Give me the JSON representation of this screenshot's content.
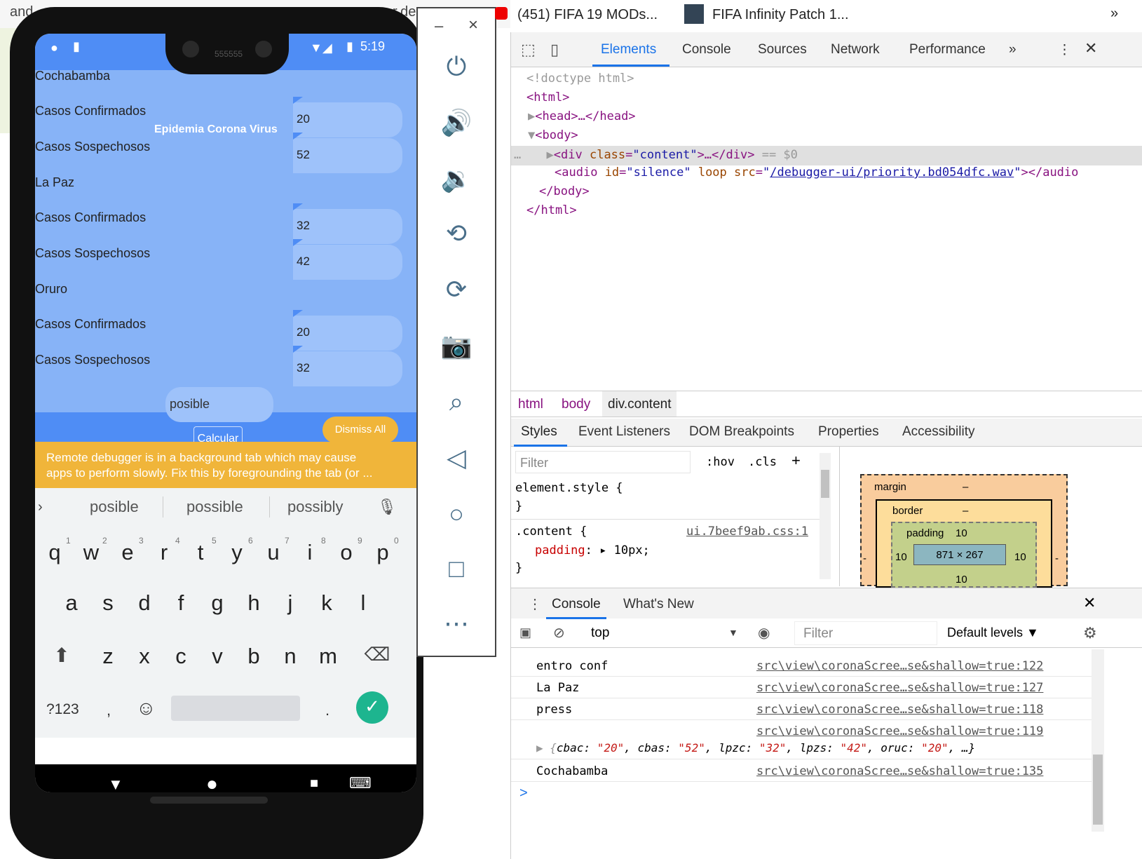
{
  "background": {
    "top_frag_left": "and",
    "top_frag_right": "r.de",
    "frag_1": "n",
    "frag_2": "t"
  },
  "browser_tabs": [
    {
      "label": "(451) FIFA 19 MODs..."
    },
    {
      "label": "FIFA Infinity Patch 1..."
    }
  ],
  "browser_more": "»",
  "phone": {
    "status": {
      "time": "5:19",
      "notch_text": "555555"
    },
    "app": {
      "title": "Epidemia Corona Virus",
      "sections": [
        {
          "name": "Cochabamba",
          "fields": [
            {
              "label": "Casos Confirmados",
              "value": "20"
            },
            {
              "label": "Casos Sospechosos",
              "value": "52"
            }
          ]
        },
        {
          "name": "La Paz",
          "fields": [
            {
              "label": "Casos Confirmados",
              "value": "32"
            },
            {
              "label": "Casos Sospechosos",
              "value": "42"
            }
          ]
        },
        {
          "name": "Oruro",
          "fields": [
            {
              "label": "Casos Confirmados",
              "value": "20"
            },
            {
              "label": "Casos Sospechosos",
              "value": "32"
            }
          ]
        }
      ],
      "input_value": "posible",
      "calc_button": "Calcular",
      "dismiss_button": "Dismiss All",
      "banner_line1": "Remote debugger is in a background tab which may cause",
      "banner_line2": "apps to perform slowly. Fix this by foregrounding the tab (or ..."
    },
    "keyboard": {
      "suggestions": [
        "posible",
        "possible",
        "possibly"
      ],
      "row1": [
        "q",
        "w",
        "e",
        "r",
        "t",
        "y",
        "u",
        "i",
        "o",
        "p"
      ],
      "row1_nums": [
        "1",
        "2",
        "3",
        "4",
        "5",
        "6",
        "7",
        "8",
        "9",
        "0"
      ],
      "row2": [
        "a",
        "s",
        "d",
        "f",
        "g",
        "h",
        "j",
        "k",
        "l"
      ],
      "row3": [
        "z",
        "x",
        "c",
        "v",
        "b",
        "n",
        "m"
      ],
      "symbols_key": "?123",
      "comma": ",",
      "period": "."
    }
  },
  "emulator": {
    "minimize": "–",
    "close": "×",
    "icons": [
      "power-icon",
      "volume-up-icon",
      "volume-down-icon",
      "rotate-left-icon",
      "rotate-right-icon",
      "camera-icon",
      "zoom-icon",
      "back-icon",
      "home-icon",
      "overview-icon",
      "more-icon"
    ]
  },
  "devtools": {
    "tabs": [
      "Elements",
      "Console",
      "Sources",
      "Network",
      "Performance"
    ],
    "more_tabs": "»",
    "dom": {
      "doctype": "<!doctype html>",
      "html_open": "<html>",
      "head": "<head>…</head>",
      "body_open": "<body>",
      "div_tag": "div",
      "div_class_attr": "class",
      "div_class_val": "content",
      "div_suffix": ">…</div>",
      "div_eq": "== $0",
      "audio_tag": "audio",
      "audio_id_attr": "id",
      "audio_id_val": "silence",
      "audio_loop": "loop",
      "audio_src_attr": "src",
      "audio_src_val": "/debugger-ui/priority.bd054dfc.wav",
      "audio_close": "></audio",
      "body_close": "</body>",
      "html_close": "</html>"
    },
    "breadcrumb": [
      "html",
      "body",
      "div.content"
    ],
    "subtabs": [
      "Styles",
      "Event Listeners",
      "DOM Breakpoints",
      "Properties",
      "Accessibility"
    ],
    "styles": {
      "filter_placeholder": "Filter",
      "hov": ":hov",
      "cls": ".cls",
      "add": "+",
      "rule1_selector": "element.style {",
      "rule1_close": "}",
      "rule2_selector": ".content {",
      "rule2_source": "ui.7beef9ab.css:1",
      "rule2_prop": "padding",
      "rule2_value": "10px;",
      "rule2_close": "}"
    },
    "box_model": {
      "margin_label": "margin",
      "margin_value": "–",
      "border_label": "border",
      "border_value": "–",
      "padding_label": "padding",
      "padding_top": "10",
      "padding_left": "10",
      "padding_right": "10",
      "padding_bottom": "10",
      "content_size": "871 × 267",
      "margin_left": "-",
      "margin_right": "-"
    },
    "drawer": {
      "tabs": [
        "Console",
        "What's New"
      ],
      "context": "top",
      "filter_placeholder": "Filter",
      "levels": "Default levels ▼"
    },
    "console_log": [
      {
        "msg": "entro conf",
        "src": "src\\view\\coronaScree…se&shallow=true:122"
      },
      {
        "msg": "La Paz",
        "src": "src\\view\\coronaScree…se&shallow=true:127"
      },
      {
        "msg": "press",
        "src": "src\\view\\coronaScree…se&shallow=true:118"
      },
      {
        "msg": "",
        "src": "src\\view\\coronaScree…se&shallow=true:119"
      },
      {
        "msg": "Cochabamba",
        "src": "src\\view\\coronaScree…se&shallow=true:135"
      }
    ],
    "object_preview": {
      "open": "▶ {",
      "k1": "cbac",
      "v1": "\"20\"",
      "k2": "cbas",
      "v2": "\"52\"",
      "k3": "lpzc",
      "v3": "\"32\"",
      "k4": "lpzs",
      "v4": "\"42\"",
      "k5": "oruc",
      "v5": "\"20\"",
      "tail": "…}"
    },
    "prompt": ">"
  },
  "colors": {
    "app_blue": "#4f8df5",
    "app_light": "#87b3f7",
    "banner": "#f0b53a",
    "accent_green": "#1db58f"
  }
}
